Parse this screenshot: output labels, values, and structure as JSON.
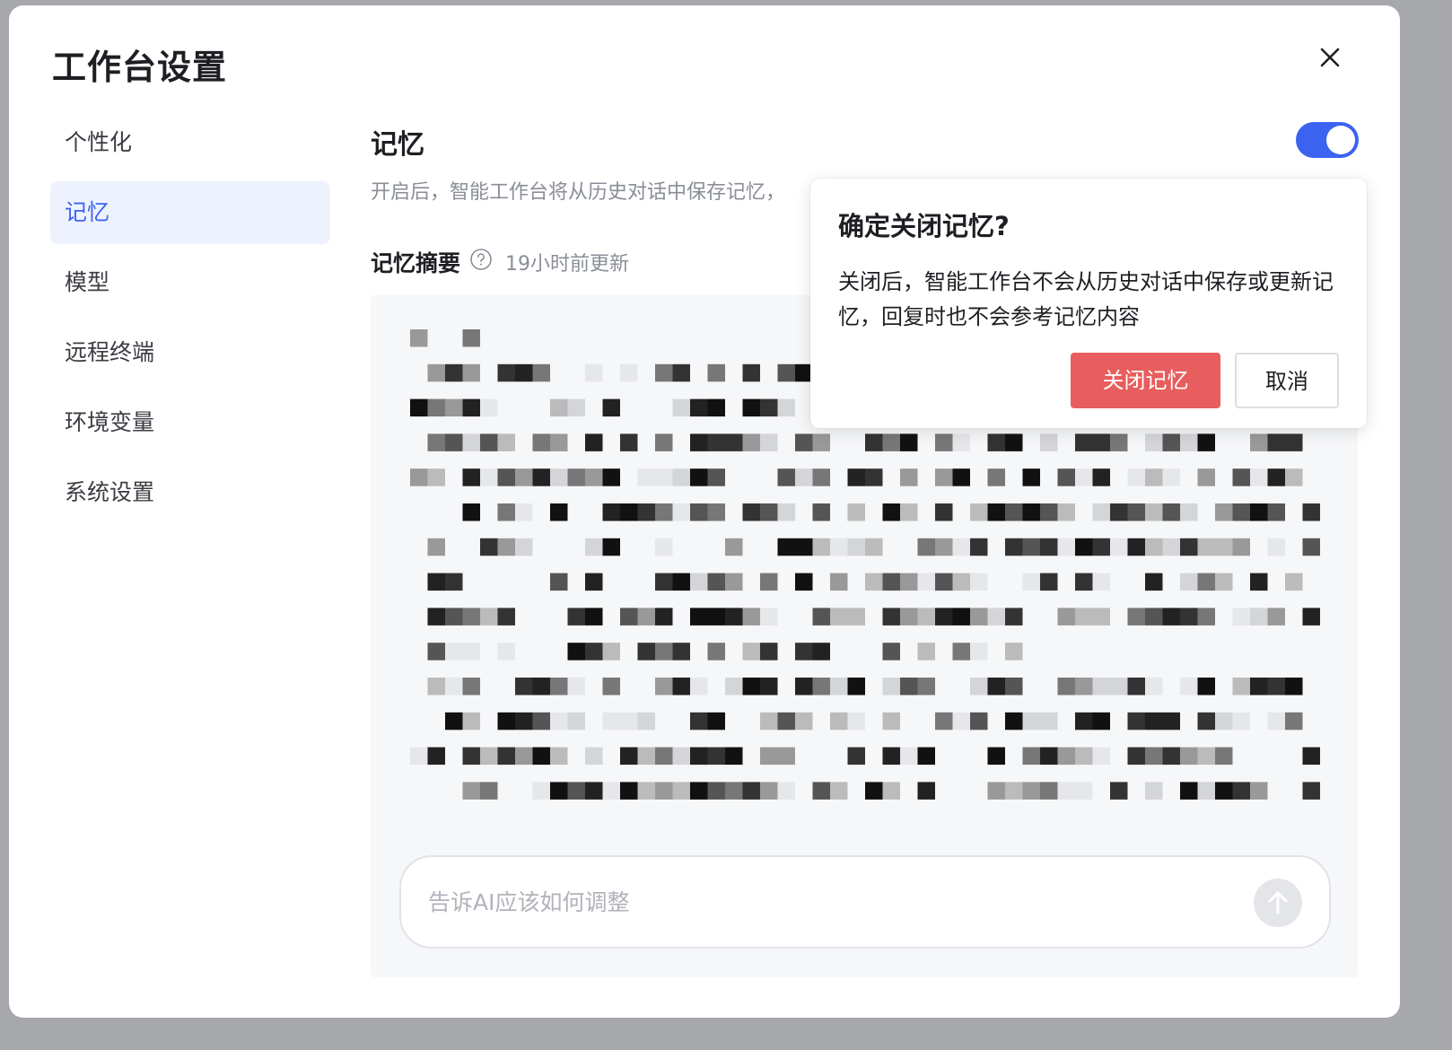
{
  "dialog": {
    "title": "工作台设置",
    "close_icon": "close-icon"
  },
  "nav": {
    "items": [
      {
        "label": "个性化",
        "active": false
      },
      {
        "label": "记忆",
        "active": true
      },
      {
        "label": "模型",
        "active": false
      },
      {
        "label": "远程终端",
        "active": false
      },
      {
        "label": "环境变量",
        "active": false
      },
      {
        "label": "系统设置",
        "active": false
      }
    ]
  },
  "memory": {
    "title": "记忆",
    "description": "开启后，智能工作台将从历史对话中保存记忆，",
    "toggle_on": true,
    "summary_label": "记忆摘要",
    "summary_help_icon": "question-circle-icon",
    "summary_updated": "19小时前更新",
    "content_obscured": true,
    "input_placeholder": "告诉AI应该如何调整",
    "send_icon": "arrow-up-icon"
  },
  "popover": {
    "title": "确定关闭记忆?",
    "body": "关闭后，智能工作台不会从历史对话中保存或更新记忆，回复时也不会参考记忆内容",
    "confirm_label": "关闭记忆",
    "cancel_label": "取消"
  },
  "colors": {
    "accent": "#3c63f0",
    "danger": "#e85d5d",
    "nav_active_bg": "#eef2fe",
    "muted_text": "#8a8e96"
  }
}
